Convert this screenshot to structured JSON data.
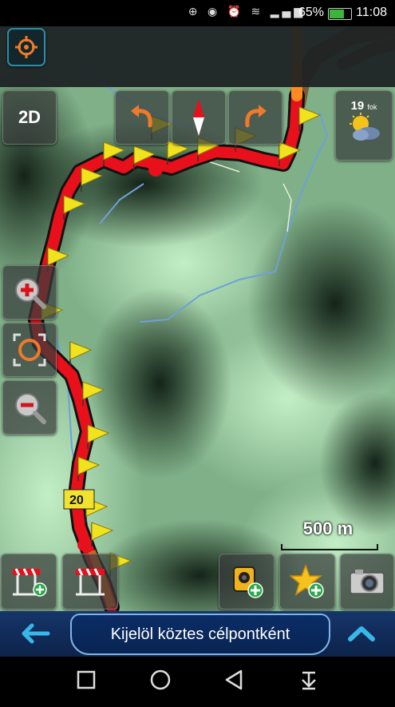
{
  "status_bar": {
    "icons": [
      "sim-icon",
      "location-icon",
      "alarm-icon",
      "wifi-icon",
      "signal-icon"
    ],
    "battery_percent": "65%",
    "battery_level": 0.65,
    "time": "11:08"
  },
  "top_bar": {
    "gps_icon": "crosshair-icon"
  },
  "map": {
    "view_mode_label": "2D",
    "compass_icon": "compass-icon",
    "undo_icon": "rotate-left-icon",
    "redo_icon": "rotate-right-icon",
    "road_label": "20",
    "scale_label": "500 m"
  },
  "weather": {
    "temperature": "19",
    "unit": "fok",
    "icon": "partly-cloudy-icon"
  },
  "side_controls": {
    "zoom_in_icon": "zoom-in-icon",
    "center_icon": "center-location-icon",
    "zoom_out_icon": "zoom-out-icon"
  },
  "bottom_tools": [
    "road-block-add-icon",
    "road-block-icon",
    "speed-camera-add-icon",
    "favorite-add-icon",
    "camera-icon"
  ],
  "bottom_bar": {
    "back_icon": "arrow-left-icon",
    "action_label": "Kijelöl köztes célpontként",
    "up_icon": "chevron-up-icon"
  },
  "nav_bar": [
    "recent-apps-icon",
    "home-icon",
    "back-icon",
    "notifications-icon"
  ],
  "colors": {
    "route": "#e8101a",
    "flag": "#f0e21c",
    "accent": "#38b7e8",
    "bar": "#0d234a"
  }
}
